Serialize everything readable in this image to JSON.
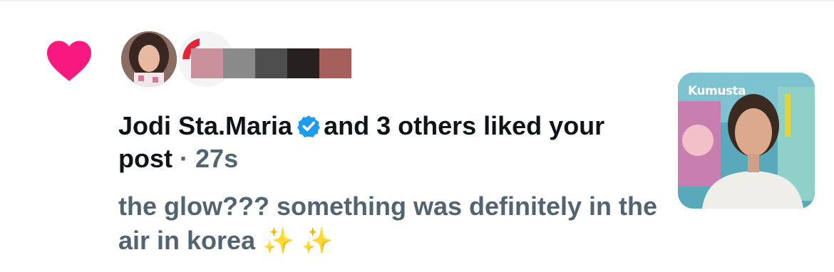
{
  "notification": {
    "type": "like",
    "icon": "heart-icon",
    "accent_color": "#f91880",
    "verified_color": "#1d9bf0",
    "liker_name": "Jodi Sta.Maria",
    "action_text": "and 3 others liked your post",
    "separator": "·",
    "timestamp": "27s",
    "post_text": "the glow??? something was definitely in the air in korea ✨ ✨",
    "thumbnail": {
      "brand_text": "Kumusta"
    }
  }
}
